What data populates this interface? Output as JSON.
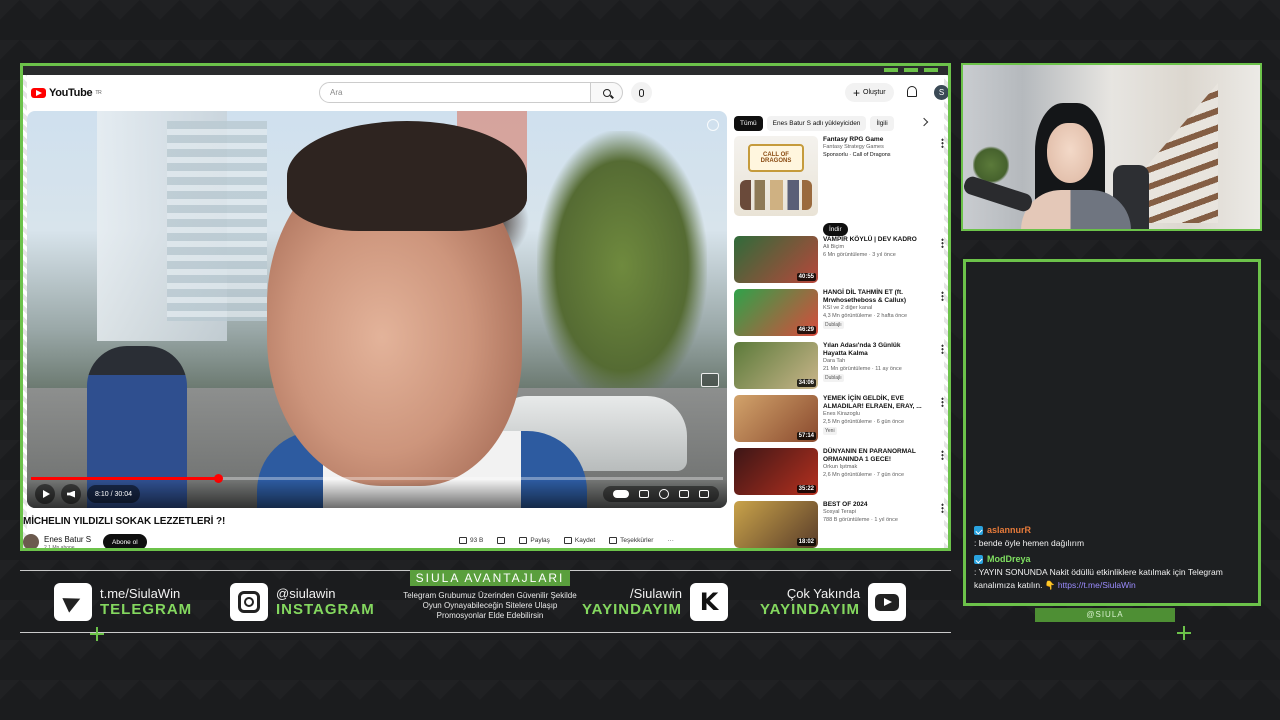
{
  "youtube": {
    "logo_text": "YouTube",
    "logo_region": "TR",
    "search_placeholder": "Ara",
    "create_label": "Oluştur",
    "avatar_letter": "S"
  },
  "video": {
    "title": "MİCHELIN YILDIZLI SOKAK LEZZETLERİ ?!",
    "time": "8:10 / 30:04",
    "progress_fraction": 0.27,
    "channel_name": "Enes Batur S",
    "channel_subs": "2,1 Mn abone",
    "subscribe_label": "Abone ol",
    "actions": [
      "93 B",
      "",
      "Paylaş",
      "Kaydet",
      "Teşekkürler"
    ]
  },
  "chips": [
    "Tümü",
    "Enes Batur S adlı yükleyiciden",
    "İlgili"
  ],
  "ad": {
    "title": "Fantasy RPG Game",
    "subtitle": "Fantasy Strategy Games",
    "sponsor": "Sponsorlu · Call of Dragons",
    "install_label": "İndir",
    "logo_text": "CALL OF DRAGONS"
  },
  "recommendations": [
    {
      "title": "VAMPİR KÖYLÜ | DEV KADRO",
      "channel": "Ali Biçim",
      "meta": "6 Mn görüntüleme · 3 yıl önce",
      "duration": "40:55",
      "badge": "",
      "colors": [
        "#2f6b3a",
        "#b8473b"
      ]
    },
    {
      "title": "HANGİ DİL TAHMİN ET (ft. Mrwhosetheboss & Callux)",
      "channel": "KSI ve 2 diğer kanal",
      "meta": "4,3 Mn görüntüleme · 2 hafta önce",
      "duration": "46:29",
      "badge": "Dublajlı",
      "colors": [
        "#2fa24a",
        "#d94a3c"
      ]
    },
    {
      "title": "Yılan Adası'nda 3 Günlük Hayatta Kalma",
      "channel": "Dara Tah",
      "meta": "21 Mn görüntüleme · 11 ay önce",
      "duration": "34:06",
      "badge": "Dublajlı",
      "colors": [
        "#5b7a3a",
        "#c9b58a"
      ]
    },
    {
      "title": "YEMEK İÇİN GELDİK, EVE ALMADILAR! ELRAEN, ERAY, ...",
      "channel": "Enes Kirazoglu",
      "meta": "2,5 Mn görüntüleme · 6 gün önce",
      "duration": "57:14",
      "badge": "Yeni",
      "colors": [
        "#d2a36b",
        "#8a4a2e"
      ]
    },
    {
      "title": "DÜNYANIN EN PARANORMAL ORMANINDA 1 GECE!",
      "channel": "Orkun Işıtmak",
      "meta": "2,6 Mn görüntüleme · 7 gün önce",
      "duration": "35:22",
      "badge": "",
      "colors": [
        "#3c1616",
        "#b5301f"
      ]
    },
    {
      "title": "BEST OF 2024",
      "channel": "Sosyal Terapi",
      "meta": "788 B görüntüleme · 1 yıl önce",
      "duration": "18:02",
      "badge": "",
      "colors": [
        "#c9a34a",
        "#5a3d2a"
      ]
    }
  ],
  "chat": [
    {
      "user": "aslannurR",
      "text": ": bende öyle hemen dağılırım",
      "link": ""
    },
    {
      "user": "ModDreya",
      "text": ": YAYIN SONUNDA Nakit ödüllü etkinliklere katılmak için Telegram kanalımıza katılın. 👇 ",
      "link": "https://t.me/SiulaWin"
    }
  ],
  "siula_tag": "@SIULA",
  "social": {
    "telegram": {
      "handle": "t.me/SiulaWin",
      "label": "TELEGRAM"
    },
    "instagram": {
      "handle": "@siulawin",
      "label": "INSTAGRAM"
    },
    "avantaj_title": "SIULA AVANTAJLARI",
    "avantaj_desc": "Telegram Grubumuz Üzerinden Güvenilir Şekilde Oyun Oynayabileceğin Sitelere Ulaşıp Promosyonlar Elde Edebilirsin",
    "kick": {
      "handle": "/Siulawin",
      "label": "YAYINDAYIM"
    },
    "youtube": {
      "handle": "Çok Yakında",
      "label": "YAYINDAYIM"
    }
  },
  "colors": {
    "accent": "#6cc24a",
    "yt_red": "#ff0000",
    "telegram_blue": "#2aa3df"
  }
}
